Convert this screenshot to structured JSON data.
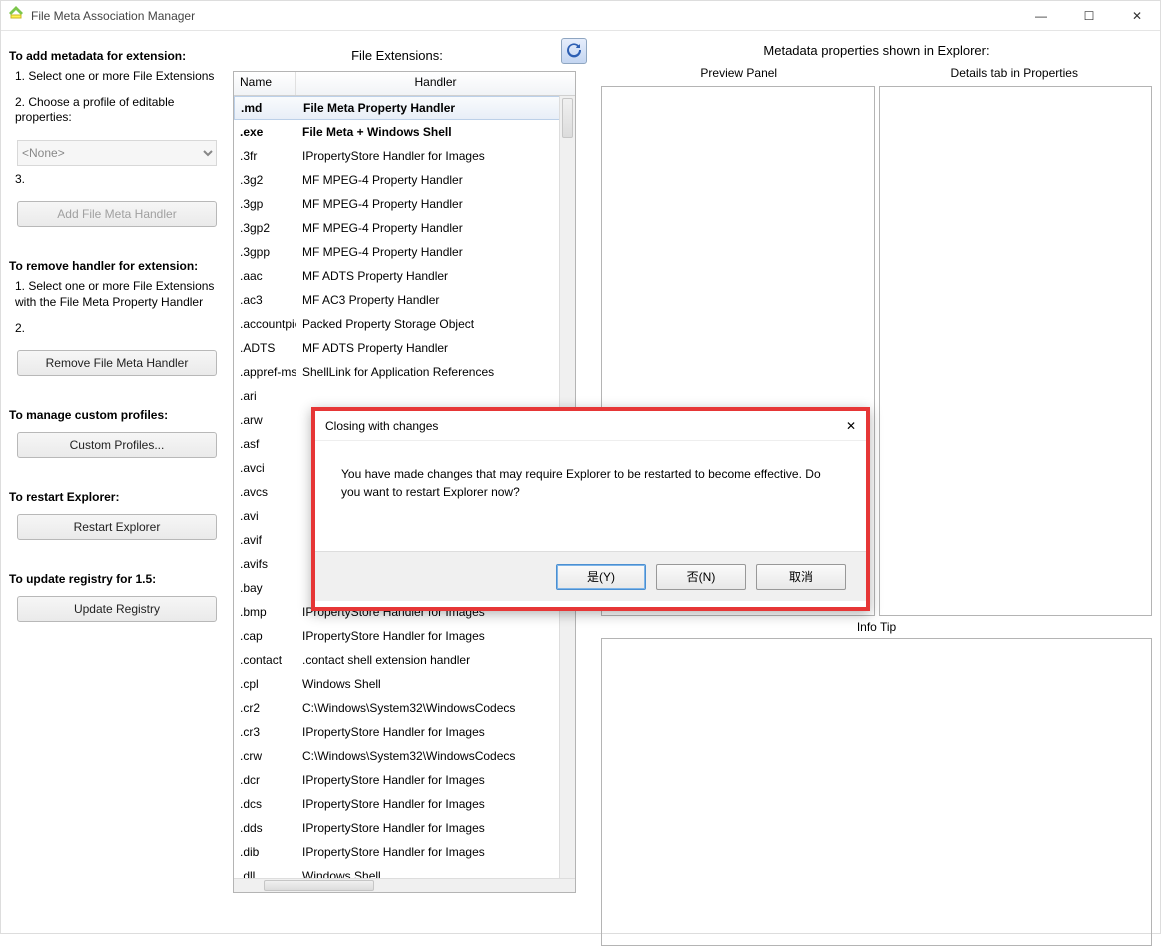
{
  "window": {
    "title": "File Meta Association Manager"
  },
  "captions": {
    "minimize": "—",
    "maximize": "☐",
    "close": "✕"
  },
  "left": {
    "add_heading": "To add metadata for extension:",
    "step1": "1. Select one or more File Extensions",
    "step2": "2. Choose a profile of editable properties:",
    "profile_selected": "<None>",
    "step3": "3.",
    "add_button": "Add File Meta Handler",
    "remove_heading": "To remove handler for extension:",
    "remove_step1": "1. Select one or more File Extensions with the File Meta Property Handler",
    "remove_step2": "2.",
    "remove_button": "Remove File Meta Handler",
    "profiles_heading": "To manage custom profiles:",
    "profiles_button": "Custom Profiles...",
    "restart_heading": "To restart Explorer:",
    "restart_button": "Restart Explorer",
    "update_heading": "To update registry for 1.5:",
    "update_button": "Update Registry"
  },
  "middle": {
    "title": "File Extensions:",
    "col_name": "Name",
    "col_handler": "Handler",
    "rows": [
      {
        "name": ".md",
        "handler": "File Meta Property Handler",
        "bold": true,
        "selected": true
      },
      {
        "name": ".exe",
        "handler": "File Meta + Windows Shell",
        "bold": true
      },
      {
        "name": ".3fr",
        "handler": "IPropertyStore Handler for Images"
      },
      {
        "name": ".3g2",
        "handler": "MF MPEG-4 Property Handler"
      },
      {
        "name": ".3gp",
        "handler": "MF MPEG-4 Property Handler"
      },
      {
        "name": ".3gp2",
        "handler": "MF MPEG-4 Property Handler"
      },
      {
        "name": ".3gpp",
        "handler": "MF MPEG-4 Property Handler"
      },
      {
        "name": ".aac",
        "handler": "MF ADTS Property Handler"
      },
      {
        "name": ".ac3",
        "handler": "MF AC3 Property Handler"
      },
      {
        "name": ".accountpicture-ms",
        "handler": "Packed Property Storage Object"
      },
      {
        "name": ".ADTS",
        "handler": "MF ADTS Property Handler"
      },
      {
        "name": ".appref-ms",
        "handler": "ShellLink for Application References"
      },
      {
        "name": ".ari",
        "handler": ""
      },
      {
        "name": ".arw",
        "handler": ""
      },
      {
        "name": ".asf",
        "handler": ""
      },
      {
        "name": ".avci",
        "handler": ""
      },
      {
        "name": ".avcs",
        "handler": ""
      },
      {
        "name": ".avi",
        "handler": ""
      },
      {
        "name": ".avif",
        "handler": ""
      },
      {
        "name": ".avifs",
        "handler": ""
      },
      {
        "name": ".bay",
        "handler": ""
      },
      {
        "name": ".bmp",
        "handler": "IPropertyStore Handler for Images"
      },
      {
        "name": ".cap",
        "handler": "IPropertyStore Handler for Images"
      },
      {
        "name": ".contact",
        "handler": ".contact shell extension handler"
      },
      {
        "name": ".cpl",
        "handler": "Windows Shell"
      },
      {
        "name": ".cr2",
        "handler": "C:\\Windows\\System32\\WindowsCodecs"
      },
      {
        "name": ".cr3",
        "handler": "IPropertyStore Handler for Images"
      },
      {
        "name": ".crw",
        "handler": "C:\\Windows\\System32\\WindowsCodecs"
      },
      {
        "name": ".dcr",
        "handler": "IPropertyStore Handler for Images"
      },
      {
        "name": ".dcs",
        "handler": "IPropertyStore Handler for Images"
      },
      {
        "name": ".dds",
        "handler": "IPropertyStore Handler for Images"
      },
      {
        "name": ".dib",
        "handler": "IPropertyStore Handler for Images"
      },
      {
        "name": ".dll",
        "handler": "Windows Shell"
      }
    ]
  },
  "right": {
    "title": "Metadata properties shown in Explorer:",
    "preview": "Preview Panel",
    "details": "Details tab in Properties",
    "infotip": "Info Tip"
  },
  "dialog": {
    "title": "Closing with changes",
    "body": "You have made changes that may require Explorer to be restarted to become effective. Do you want to restart Explorer now?",
    "yes": "是(Y)",
    "no": "否(N)",
    "cancel": "取消"
  }
}
